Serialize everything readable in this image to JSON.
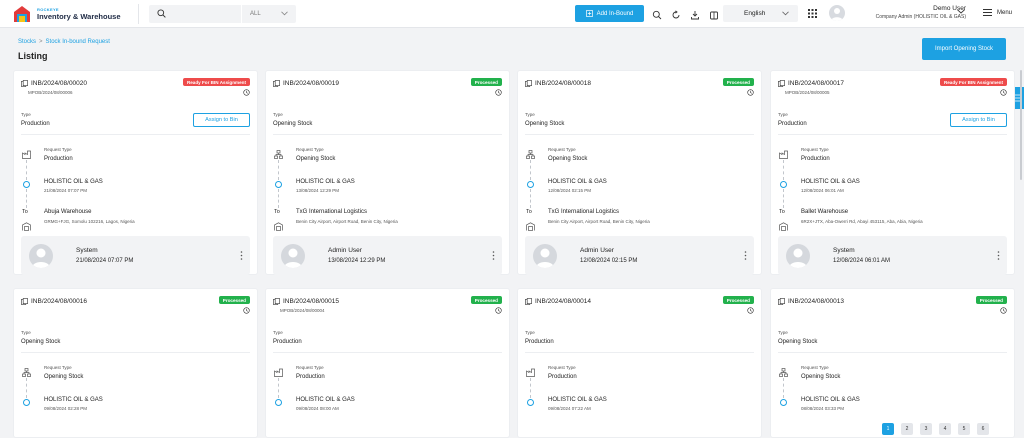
{
  "app": {
    "brand": "ROCKEYE",
    "product": "Inventory & Warehouse"
  },
  "search": {
    "placeholder": "",
    "scope": "ALL"
  },
  "header": {
    "add_inbound": "Add In-Bound",
    "language": "English",
    "user_name": "Demo User",
    "user_role": "Company Admin (HOLISTIC OIL & GAS)",
    "menu": "Menu"
  },
  "breadcrumb": {
    "root": "Stocks",
    "current": "Stock In-bound Request"
  },
  "page": {
    "title": "Listing",
    "import_button": "Import Opening Stock"
  },
  "labels": {
    "type": "Type",
    "request_type": "Request Type",
    "assign": "Assign to Bin",
    "to": "To"
  },
  "cards": [
    {
      "id": "INB/2024/08/00020",
      "ref": "MPOB/2024/08/00006",
      "status": "Ready For BIN Assignment",
      "status_color": "red",
      "type": "Production",
      "request_type": "Production",
      "from": "HOLISTIC OIL & GAS",
      "from_date": "21/08/2024 07:07 PM",
      "to": "Abuja Warehouse",
      "to_addr": "GRMG+FJG, Somolu 102216, Lagos, Nigeria",
      "user": "System",
      "user_date": "21/08/2024 07:07 PM",
      "assign": true
    },
    {
      "id": "INB/2024/08/00019",
      "ref": "",
      "status": "Processed",
      "status_color": "green",
      "type": "Opening Stock",
      "request_type": "Opening Stock",
      "from": "HOLISTIC OIL & GAS",
      "from_date": "13/08/2024 12:29 PM",
      "to": "TxG International Logistics",
      "to_addr": "Benin City Airport, Airport Road, Benin City, Nigeria",
      "user": "Admin User",
      "user_date": "13/08/2024 12:29 PM",
      "assign": false
    },
    {
      "id": "INB/2024/08/00018",
      "ref": "",
      "status": "Processed",
      "status_color": "green",
      "type": "Opening Stock",
      "request_type": "Opening Stock",
      "from": "HOLISTIC OIL & GAS",
      "from_date": "12/08/2024 02:15 PM",
      "to": "TxG International Logistics",
      "to_addr": "Benin City Airport, Airport Road, Benin City, Nigeria",
      "user": "Admin User",
      "user_date": "12/08/2024 02:15 PM",
      "assign": false
    },
    {
      "id": "INB/2024/08/00017",
      "ref": "MPOB/2024/08/00005",
      "status": "Ready For BIN Assignment",
      "status_color": "red",
      "type": "Production",
      "request_type": "Production",
      "from": "HOLISTIC OIL & GAS",
      "from_date": "12/08/2024 06:01 AM",
      "to": "Ballet Warehouse",
      "to_addr": "6R2X+JTX, Aba-Owerri Rd, Abayi 453115, Aba, Abia, Nigeria",
      "user": "System",
      "user_date": "12/08/2024 06:01 AM",
      "assign": true
    },
    {
      "id": "INB/2024/08/00016",
      "ref": "",
      "status": "Processed",
      "status_color": "green",
      "type": "Opening Stock",
      "request_type": "Opening Stock",
      "from": "HOLISTIC OIL & GAS",
      "from_date": "09/08/2024 02:28 PM"
    },
    {
      "id": "INB/2024/08/00015",
      "ref": "MPOB/2024/08/00004",
      "status": "Processed",
      "status_color": "green",
      "type": "Production",
      "request_type": "Production",
      "from": "HOLISTIC OIL & GAS",
      "from_date": "09/08/2024 08:00 AM"
    },
    {
      "id": "INB/2024/08/00014",
      "ref": "",
      "status": "Processed",
      "status_color": "green",
      "type": "Production",
      "request_type": "Production",
      "from": "HOLISTIC OIL & GAS",
      "from_date": "09/08/2024 07:22 AM"
    },
    {
      "id": "INB/2024/08/00013",
      "ref": "",
      "status": "Processed",
      "status_color": "green",
      "type": "Opening Stock",
      "request_type": "Opening Stock",
      "from": "HOLISTIC OIL & GAS",
      "from_date": "08/08/2024 03:33 PM"
    }
  ],
  "pager": [
    "1",
    "2",
    "3",
    "4",
    "5",
    "6"
  ]
}
